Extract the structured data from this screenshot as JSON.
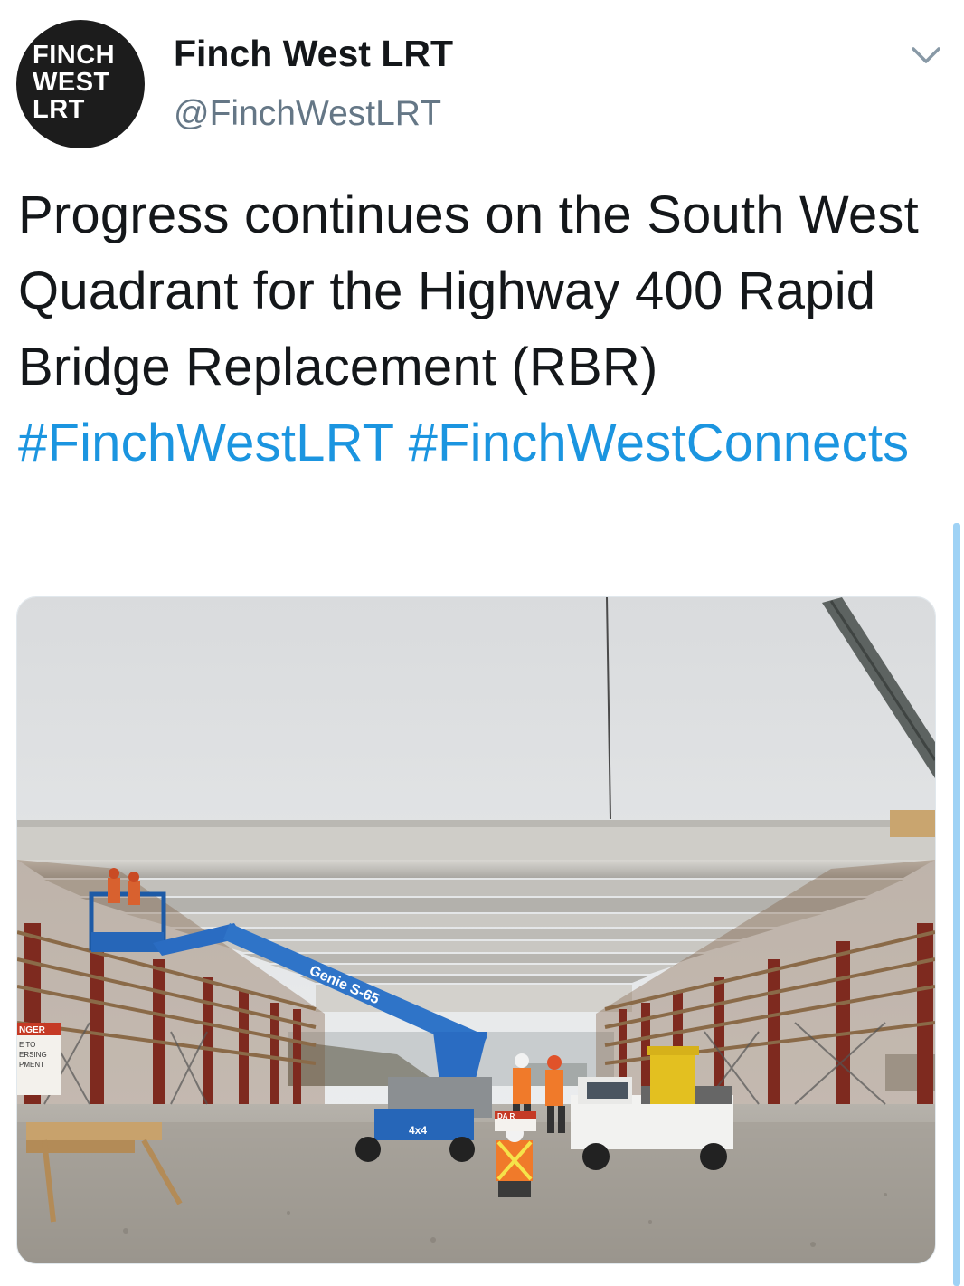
{
  "tweet": {
    "avatar": {
      "lines": [
        "FINCH",
        "WEST",
        "LRT"
      ]
    },
    "display_name": "Finch West LRT",
    "handle": "@FinchWestLRT",
    "menu_icon": "chevron-down-icon",
    "text": "Progress continues on the South West Quadrant for the Highway 400 Rapid Bridge Replacement (RBR) ",
    "hashtags": [
      "#FinchWestLRT",
      "#FinchWestConnects"
    ],
    "photo": {
      "lift_label": "Genie S-65",
      "lift_tag": "4x4",
      "sign_text": [
        "NGER",
        "E TO",
        "ERSING",
        "PMENT"
      ],
      "small_sign": "DA R"
    }
  },
  "colors": {
    "text": "#14171a",
    "secondary": "#657786",
    "link": "#1b95e0"
  }
}
